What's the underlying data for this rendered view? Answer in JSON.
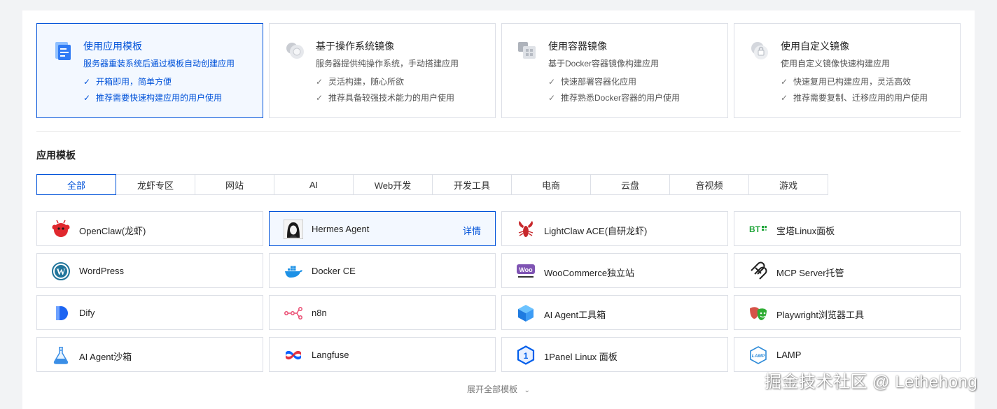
{
  "modes": [
    {
      "title": "使用应用模板",
      "desc": "服务器重装系统后通过模板自动创建应用",
      "features": [
        "开箱即用，简单方便",
        "推荐需要快速构建应用的用户使用"
      ],
      "icon": "app-template-icon"
    },
    {
      "title": "基于操作系统镜像",
      "desc": "服务器提供纯操作系统，手动搭建应用",
      "features": [
        "灵活构建，随心所欲",
        "推荐具备较强技术能力的用户使用"
      ],
      "icon": "os-image-icon"
    },
    {
      "title": "使用容器镜像",
      "desc": "基于Docker容器镜像构建应用",
      "features": [
        "快速部署容器化应用",
        "推荐熟悉Docker容器的用户使用"
      ],
      "icon": "container-image-icon"
    },
    {
      "title": "使用自定义镜像",
      "desc": "使用自定义镜像快速构建应用",
      "features": [
        "快速复用已构建应用，灵活高效",
        "推荐需要复制、迁移应用的用户使用"
      ],
      "icon": "custom-image-icon"
    }
  ],
  "section_title": "应用模板",
  "tabs": [
    "全部",
    "龙虾专区",
    "网站",
    "AI",
    "Web开发",
    "开发工具",
    "电商",
    "云盘",
    "音视频",
    "游戏"
  ],
  "templates": [
    {
      "name": "OpenClaw(龙虾)",
      "icon": "openclaw-icon"
    },
    {
      "name": "Hermes Agent",
      "icon": "hermes-avatar-icon",
      "detail": "详情"
    },
    {
      "name": "LightClaw ACE(自研龙虾)",
      "icon": "lobster-icon"
    },
    {
      "name": "宝塔Linux面板",
      "icon": "bt-panel-icon"
    },
    {
      "name": "WordPress",
      "icon": "wordpress-icon"
    },
    {
      "name": "Docker CE",
      "icon": "docker-icon"
    },
    {
      "name": "WooCommerce独立站",
      "icon": "woocommerce-icon"
    },
    {
      "name": "MCP Server托管",
      "icon": "mcp-icon"
    },
    {
      "name": "Dify",
      "icon": "dify-icon"
    },
    {
      "name": "n8n",
      "icon": "n8n-icon"
    },
    {
      "name": "AI Agent工具箱",
      "icon": "cube-toolbox-icon"
    },
    {
      "name": "Playwright浏览器工具",
      "icon": "playwright-masks-icon"
    },
    {
      "name": "AI Agent沙箱",
      "icon": "flask-icon"
    },
    {
      "name": "Langfuse",
      "icon": "langfuse-icon"
    },
    {
      "name": "1Panel Linux 面板",
      "icon": "1panel-icon"
    },
    {
      "name": "LAMP",
      "icon": "lamp-icon"
    }
  ],
  "expand_label": "展开全部模板",
  "watermark": "掘金技术社区 @ Lethehong",
  "colors": {
    "accent": "#0052d9",
    "active_bg": "#f3f8ff",
    "border": "#dcdfe6"
  }
}
